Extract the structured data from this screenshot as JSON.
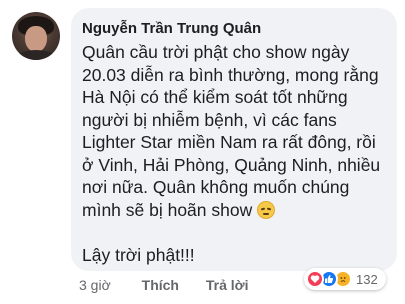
{
  "comment": {
    "author": "Nguyễn Trần Trung Quân",
    "body_lines": [
      "Quân cầu trời phật cho show ngày",
      "20.03 diễn ra bình thường, mong rằng",
      "Hà Nội có thể kiểm soát tốt những",
      "người bị nhiễm bệnh, vì các fans",
      "Lighter Star miền Nam ra rất đông, rồi",
      "ở Vinh, Hải Phòng, Quảng Ninh, nhiều",
      "nơi nữa. Quân không muốn chúng",
      "mình sẽ bị hoãn show"
    ],
    "closing": "Lậy trời phật!!!",
    "emoji": "disappointed-face"
  },
  "actions": {
    "time": "3 giờ",
    "like_label": "Thích",
    "reply_label": "Trả lời"
  },
  "reactions": {
    "types": [
      "love",
      "like",
      "sad"
    ],
    "count": "132",
    "colors": {
      "love": "#f33e58",
      "like": "#1877f2",
      "sad": "#f7b125"
    }
  }
}
